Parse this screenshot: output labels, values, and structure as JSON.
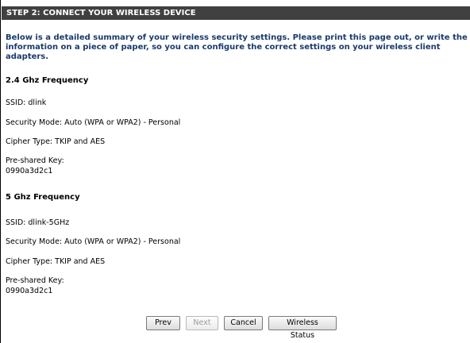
{
  "header": {
    "title": "STEP 2: CONNECT YOUR WIRELESS DEVICE"
  },
  "intro": {
    "text": "Below is a detailed summary of your wireless security settings. Please print this page out, or write the information on a piece of paper, so you can configure the correct settings on your wireless client adapters."
  },
  "band_24": {
    "title": "2.4 Ghz Frequency",
    "ssid": "SSID: dlink",
    "security_mode": "Security Mode: Auto (WPA or WPA2) - Personal",
    "cipher_type": "Cipher Type: TKIP and AES",
    "psk_label": "Pre-shared Key:",
    "psk_value": "0990a3d2c1"
  },
  "band_5": {
    "title": "5 Ghz Frequency",
    "ssid": "SSID: dlink-5GHz",
    "security_mode": "Security Mode: Auto (WPA or WPA2) - Personal",
    "cipher_type": "Cipher Type: TKIP and AES",
    "psk_label": "Pre-shared Key:",
    "psk_value": "0990a3d2c1"
  },
  "buttons": {
    "prev": "Prev",
    "next": "Next",
    "cancel": "Cancel",
    "wireless_status": "Wireless Status"
  },
  "colors": {
    "header_bg": "#404040",
    "intro_text": "#1a3a6b"
  }
}
